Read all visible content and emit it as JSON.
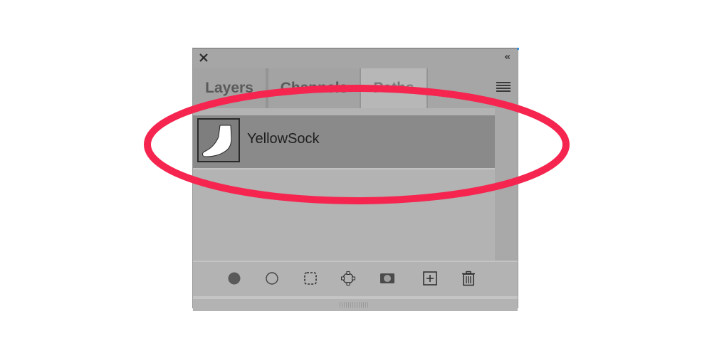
{
  "panel": {
    "title_bar": {
      "close_icon": "close-icon",
      "collapse_label": "‹‹"
    },
    "tabs": [
      {
        "label": "Layers",
        "active": false
      },
      {
        "label": "Channels",
        "active": false
      },
      {
        "label": "Paths",
        "active": true
      }
    ],
    "menu_icon": "hamburger-menu-icon",
    "paths": [
      {
        "name": "YellowSock",
        "thumbnail_icon": "sock-path-thumbnail"
      }
    ],
    "toolbar": [
      {
        "name": "fill-path-icon"
      },
      {
        "name": "stroke-path-icon"
      },
      {
        "name": "load-path-as-selection-icon"
      },
      {
        "name": "make-work-path-icon"
      },
      {
        "name": "add-mask-icon"
      },
      {
        "name": "create-new-path-icon"
      },
      {
        "name": "delete-path-icon"
      }
    ]
  },
  "colors": {
    "annotation_ellipse": "#f5254f",
    "panel_bg": "#b3b3b3",
    "selected_row": "#8a8a8a"
  }
}
